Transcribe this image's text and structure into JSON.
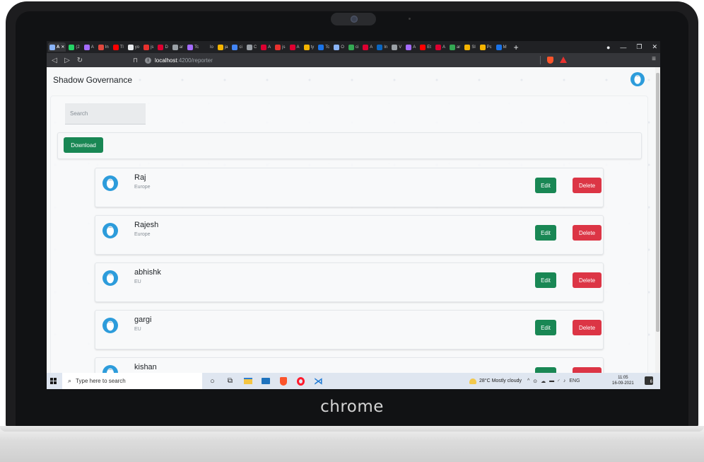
{
  "browser": {
    "tabs": [
      {
        "label": "A",
        "color": "#8ab4f8",
        "active": true
      },
      {
        "label": "(2",
        "color": "#25d366"
      },
      {
        "label": "A",
        "color": "#a46bff"
      },
      {
        "label": "In",
        "color": "#e0483e"
      },
      {
        "label": "Tl",
        "color": "#ff0000"
      },
      {
        "label": "yo",
        "color": "#e8eaed"
      },
      {
        "label": "js",
        "color": "#e8312e"
      },
      {
        "label": "D",
        "color": "#dd0031"
      },
      {
        "label": "ar",
        "color": "#9aa0a6"
      },
      {
        "label": "Tc",
        "color": "#a46bff"
      },
      {
        "label": "lo",
        "color": "#202124"
      },
      {
        "label": "ja",
        "color": "#f4b400"
      },
      {
        "label": "ci",
        "color": "#4285f4"
      },
      {
        "label": "C",
        "color": "#9aa0a6"
      },
      {
        "label": "A",
        "color": "#dd0031"
      },
      {
        "label": "js",
        "color": "#e8312e"
      },
      {
        "label": "A",
        "color": "#dd0031"
      },
      {
        "label": "ty",
        "color": "#f4b400"
      },
      {
        "label": "Tc",
        "color": "#1a73e8"
      },
      {
        "label": "O",
        "color": "#8ab4f8"
      },
      {
        "label": "ci",
        "color": "#34a853"
      },
      {
        "label": "A",
        "color": "#dd0031"
      },
      {
        "label": "In",
        "color": "#0a66c2"
      },
      {
        "label": "V",
        "color": "#9aa0a6"
      },
      {
        "label": "A",
        "color": "#a46bff"
      },
      {
        "label": "Et",
        "color": "#ff0000"
      },
      {
        "label": "A",
        "color": "#dd0031"
      },
      {
        "label": "ar",
        "color": "#34a853"
      },
      {
        "label": "Sl",
        "color": "#f4b400"
      },
      {
        "label": "Pc",
        "color": "#f4b400"
      },
      {
        "label": "M",
        "color": "#1a73e8"
      }
    ],
    "new_tab_label": "+",
    "url_host": "localhost",
    "url_path": ":4200/reporter",
    "brave_color": "#fb542b"
  },
  "app": {
    "title": "Shadow Governance",
    "search_placeholder": "Search",
    "download_label": "Download",
    "edit_label": "Edit",
    "delete_label": "Delete",
    "primary_color": "#198754",
    "danger_color": "#dc3545"
  },
  "users": [
    {
      "name": "Raj",
      "region": "Europe"
    },
    {
      "name": "Rajesh",
      "region": "Europe"
    },
    {
      "name": "abhishk",
      "region": "EU"
    },
    {
      "name": "gargi",
      "region": "EU"
    },
    {
      "name": "kishan",
      "region": ""
    }
  ],
  "taskbar": {
    "search_text": "Type here to search",
    "weather": "28°C  Mostly cloudy",
    "language": "ENG",
    "time": "11:05",
    "date": "16-09-2021",
    "notifications": "6"
  },
  "device": {
    "brand": "chrome"
  }
}
